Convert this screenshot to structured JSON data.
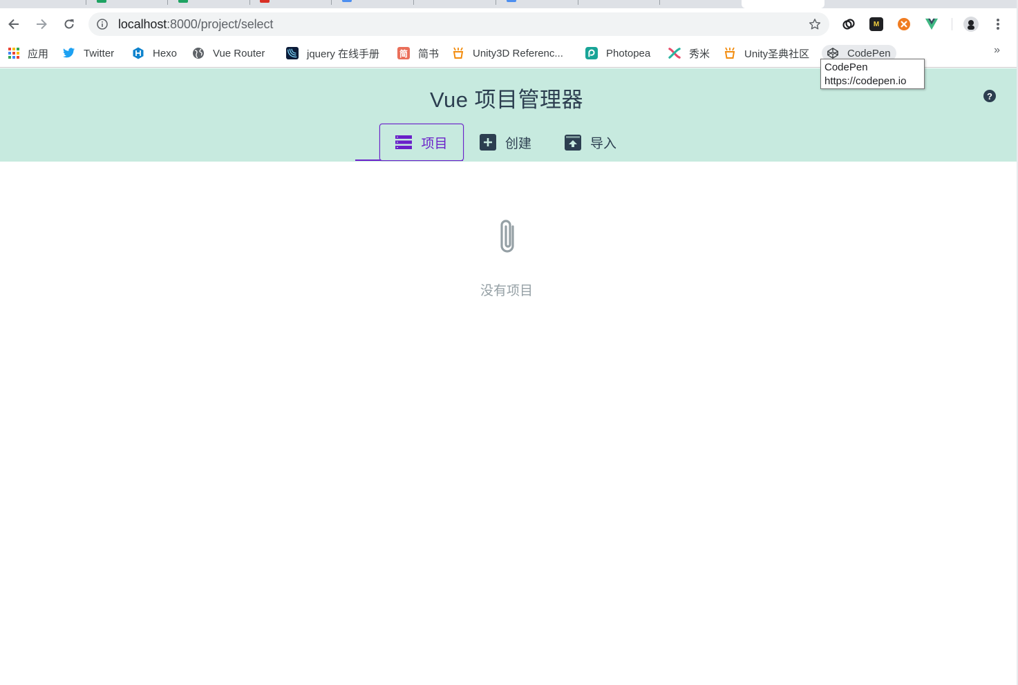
{
  "browser": {
    "url_host": "localhost",
    "url_path": ":8000/project/select",
    "bookmarks": [
      {
        "label": "应用",
        "icon": "apps-grid-icon"
      },
      {
        "label": "Twitter",
        "icon": "twitter-icon"
      },
      {
        "label": "Hexo",
        "icon": "hexo-icon"
      },
      {
        "label": "Vue Router",
        "icon": "globe-icon"
      },
      {
        "label": "jquery 在线手册",
        "icon": "jquery-icon"
      },
      {
        "label": "简书",
        "icon": "jianshu-icon",
        "glyph": "简"
      },
      {
        "label": "Unity3D Referenc...",
        "icon": "unity-icon"
      },
      {
        "label": "Photopea",
        "icon": "photopea-icon"
      },
      {
        "label": "秀米",
        "icon": "xiumi-icon"
      },
      {
        "label": "Unity圣典社区",
        "icon": "unity-icon"
      },
      {
        "label": "CodePen",
        "icon": "codepen-icon"
      }
    ],
    "more_bookmarks": "»",
    "tooltip": {
      "title": "CodePen",
      "url": "https://codepen.io"
    }
  },
  "app": {
    "title": "Vue 项目管理器",
    "help": "?",
    "tabs": [
      {
        "label": "项目",
        "icon": "list-icon",
        "active": true
      },
      {
        "label": "创建",
        "icon": "plus-box-icon",
        "active": false
      },
      {
        "label": "导入",
        "icon": "import-icon",
        "active": false
      }
    ],
    "empty_message": "没有项目"
  },
  "colors": {
    "header_bg": "#c7eadf",
    "accent": "#6a20c9",
    "text_dark": "#2c3e50",
    "muted": "#95a0a5"
  }
}
